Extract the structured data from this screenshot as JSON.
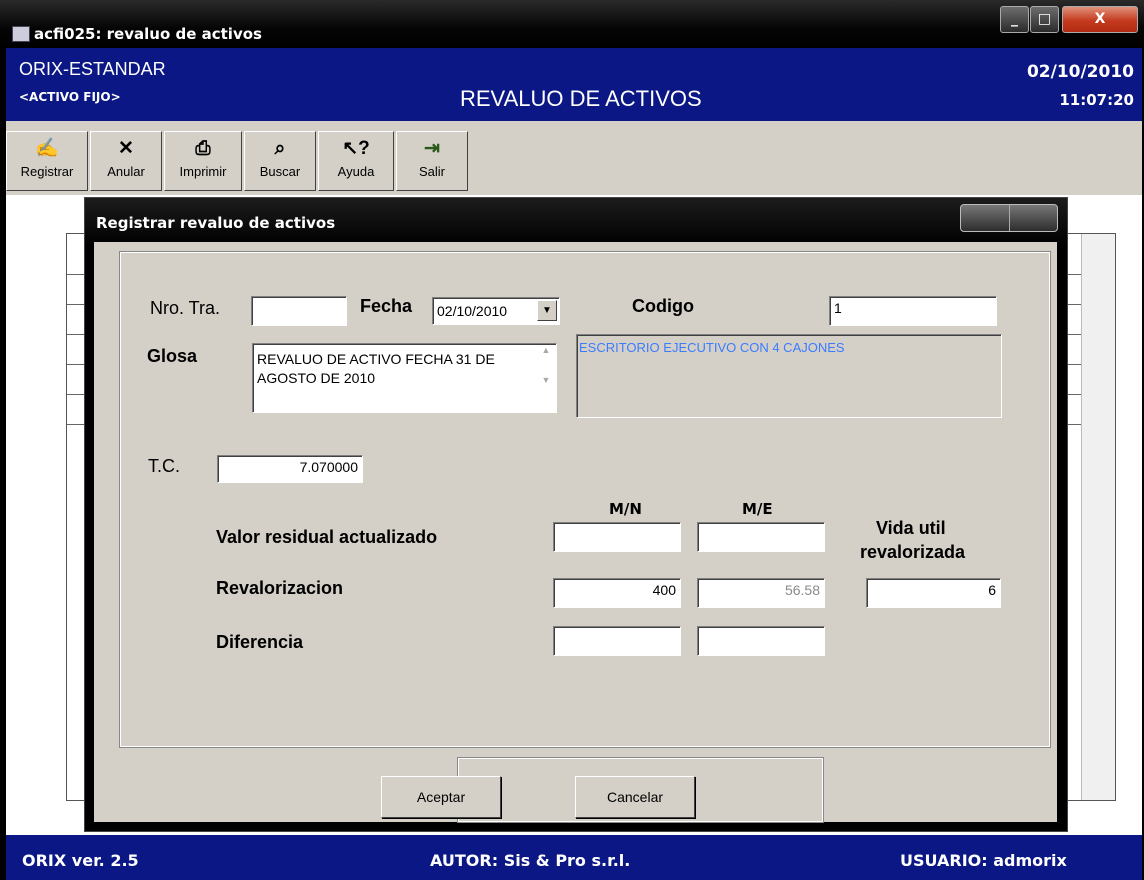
{
  "window": {
    "title": "acfi025: revaluo de activos",
    "buttons": {
      "minimize": "_",
      "maximize": "□",
      "close": "X"
    }
  },
  "header": {
    "company": "ORIX-ESTANDAR",
    "module": "<ACTIVO FIJO>",
    "page_title": "REVALUO DE ACTIVOS",
    "date": "02/10/2010",
    "time": "11:07:20"
  },
  "toolbar": {
    "items": [
      {
        "label": "Registrar",
        "icon": "register-icon",
        "glyph": "✍"
      },
      {
        "label": "Anular",
        "icon": "cancel-icon",
        "glyph": "✕"
      },
      {
        "label": "Imprimir",
        "icon": "printer-icon",
        "glyph": "⎙"
      },
      {
        "label": "Buscar",
        "icon": "binoculars-icon",
        "glyph": "⌕"
      },
      {
        "label": "Ayuda",
        "icon": "help-icon",
        "glyph": "↖?"
      },
      {
        "label": "Salir",
        "icon": "exit-icon",
        "glyph": "⇥"
      }
    ]
  },
  "dialog": {
    "title": "Registrar revaluo de activos",
    "nro_tra": {
      "label": "Nro. Tra.",
      "value": ""
    },
    "fecha": {
      "label": "Fecha",
      "value": "02/10/2010"
    },
    "codigo": {
      "label": "Codigo",
      "value": "1"
    },
    "glosa": {
      "label": "Glosa",
      "value": "REVALUO DE ACTIVO  FECHA 31 DE AGOSTO DE 2010"
    },
    "descripcion": "ESCRITORIO EJECUTIVO CON 4 CAJONES",
    "tc": {
      "label": "T.C.",
      "value": "7.070000"
    },
    "col_mn": "M/N",
    "col_me": "M/E",
    "vida_util_label_1": "Vida util",
    "vida_util_label_2": "revalorizada",
    "rows": {
      "valor_residual": {
        "label": "Valor residual actualizado",
        "mn": "",
        "me": ""
      },
      "revalorizacion": {
        "label": "Revalorizacion",
        "mn": "400",
        "me": "56.58",
        "vida_util": "6"
      },
      "diferencia": {
        "label": "Diferencia",
        "mn": "",
        "me": ""
      }
    },
    "accept_label": "Aceptar",
    "cancel_label": "Cancelar"
  },
  "status": {
    "version": "ORIX ver. 2.5",
    "author": "AUTOR: Sis & Pro s.r.l.",
    "user": "USUARIO: admorix"
  },
  "colors": {
    "header_bg": "#0a1784",
    "dialog_bg": "#d4d0c8",
    "description_text": "#3b7cff"
  }
}
